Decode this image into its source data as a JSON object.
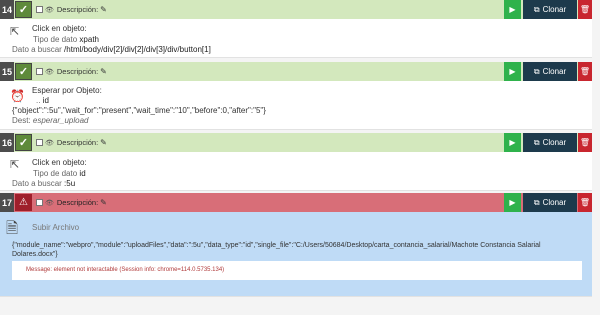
{
  "steps": [
    {
      "number": "14",
      "description_label": "Descripción:",
      "action": "Click en objeto:",
      "data_type_label": "Tipo de dato",
      "data_type_value": "xpath",
      "search_label": "Dato a buscar",
      "search_value": "/html/body/div[2]/div[2]/div[3]/div/button[1]"
    },
    {
      "number": "15",
      "description_label": "Descripción:",
      "action": "Esperar por Objeto:",
      "data_type_value": "id",
      "params": "{\"object\":\":5u\",\"wait_for\":\"present\",\"wait_time\":\"10\",\"before\":0,\"after\":\"5\"}",
      "dest_label": "Dest:",
      "dest_value": "esperar_upload"
    },
    {
      "number": "16",
      "description_label": "Descripción:",
      "action": "Click en objeto:",
      "data_type_label": "Tipo de dato",
      "data_type_value": "id",
      "search_label": "Dato a buscar",
      "search_value": ":5u"
    },
    {
      "number": "17",
      "description_label": "Descripción:",
      "action": "Subir Archivo",
      "params_line1": "{\"module_name\":\"webpro\",\"module\":\"uploadFiles\",\"data\":\":5u\",\"data_type\":\"id\",\"single_file\":\"C:/Users/50684/Desktop/carta_contancia_salarial/Machote Constancia Salarial",
      "params_line2": "Dolares.docx\"}",
      "message": "Message: element not interactable (Session info: chrome=114.0.5735.134)"
    }
  ],
  "buttons": {
    "clone_label": "Clonar"
  },
  "colors": {
    "ok_header": "#d3e8bd",
    "error_header": "#d86e78",
    "error_body": "#bfdbf6",
    "play": "#2fb24c",
    "clone": "#1d3a4c",
    "delete": "#c8262f"
  },
  "icons": [
    "check-icon",
    "warning-icon",
    "eye-slash-icon",
    "pencil-icon",
    "play-icon",
    "copy-icon",
    "trash-icon",
    "cursor-click-icon",
    "alarm-clock-icon",
    "file-upload-icon"
  ]
}
